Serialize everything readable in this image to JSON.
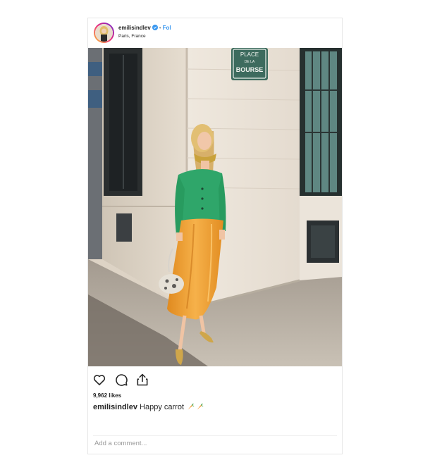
{
  "post": {
    "username": "emilisindlev",
    "follow_label": "Fol",
    "location": "Paris, France",
    "likes": "9,962 likes",
    "caption_user": "emilisindlev",
    "caption_text": "Happy carrot",
    "caption_emojis": [
      "carrot-icon",
      "carrot-icon"
    ],
    "comment_placeholder": "Add a comment..."
  },
  "photo": {
    "street_sign_lines": [
      "PLACE",
      "DE LA",
      "BOURSE"
    ]
  },
  "colors": {
    "verified_blue": "#3897f0",
    "follow_blue": "#3897f0",
    "cardigan_green": "#2fa66a",
    "skirt_orange": "#f0a230"
  }
}
